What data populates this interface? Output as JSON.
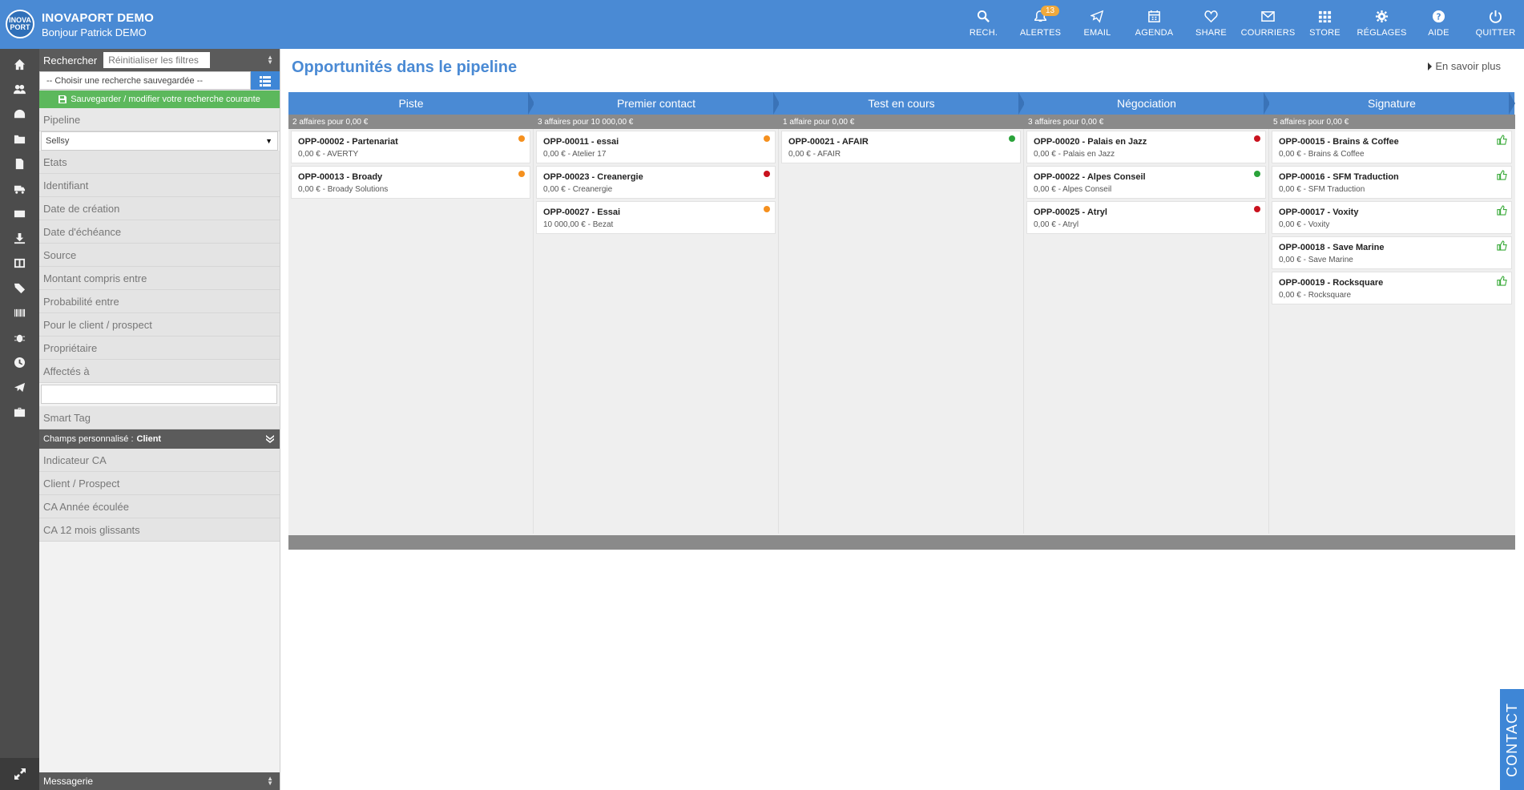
{
  "header": {
    "logo_line1": "INOVA",
    "logo_line2": "PORT",
    "app_name": "INOVAPORT DEMO",
    "greeting": "Bonjour Patrick DEMO",
    "nav": [
      {
        "id": "search",
        "label": "RECH.",
        "icon": "search-icon"
      },
      {
        "id": "alerts",
        "label": "ALERTES",
        "icon": "bell-icon",
        "badge": "13"
      },
      {
        "id": "email",
        "label": "EMAIL",
        "icon": "paper-plane-icon"
      },
      {
        "id": "agenda",
        "label": "AGENDA",
        "icon": "calendar-icon"
      },
      {
        "id": "share",
        "label": "SHARE",
        "icon": "heart-icon"
      },
      {
        "id": "courriers",
        "label": "COURRIERS",
        "icon": "envelope-icon"
      },
      {
        "id": "store",
        "label": "STORE",
        "icon": "grid-icon"
      },
      {
        "id": "settings",
        "label": "RÉGLAGES",
        "icon": "gear-icon"
      },
      {
        "id": "help",
        "label": "AIDE",
        "icon": "question-icon"
      },
      {
        "id": "quit",
        "label": "QUITTER",
        "icon": "power-icon"
      }
    ]
  },
  "rail": {
    "icons": [
      "home-icon",
      "users-icon",
      "dashboard-icon",
      "folder-icon",
      "document-icon",
      "truck-icon",
      "money-icon",
      "download-icon",
      "columns-icon",
      "tags-icon",
      "barcode-icon",
      "bug-icon",
      "clock-icon",
      "send-icon",
      "briefcase-icon"
    ],
    "bottom_icon": "expand-icon"
  },
  "filters": {
    "search_label": "Rechercher",
    "reset_label": "Réinitialiser les filtres",
    "saved_search_placeholder": "-- Choisir une recherche sauvegardée --",
    "save_button": "Sauvegarder / modifier votre recherche courante",
    "pipeline_label": "Pipeline",
    "pipeline_value": "Sellsy",
    "items_before_input": [
      "Etats",
      "Identifiant",
      "Date de création",
      "Date d'échéance",
      "Source",
      "Montant compris entre",
      "Probabilité entre",
      "Pour le client / prospect",
      "Propriétaire",
      "Affectés à"
    ],
    "smart_tag": "Smart Tag",
    "custom_fields_label": "Champs personnalisé :",
    "custom_fields_value": "Client",
    "custom_items": [
      "Indicateur CA",
      "Client / Prospect",
      "CA Année écoulée",
      "CA 12 mois glissants"
    ],
    "messagerie": "Messagerie"
  },
  "main": {
    "title": "Opportunités dans le pipeline",
    "learn_more": "En savoir plus",
    "colors": {
      "orange": "#f5901e",
      "red": "#c9121e",
      "green": "#2aa33a",
      "thumb": "#3bab3b"
    },
    "stages": [
      {
        "name": "Piste",
        "summary": "2 affaires pour 0,00 €",
        "cards": [
          {
            "title": "OPP-00002 - Partenariat",
            "sub": "0,00 € - AVERTY",
            "status": "orange"
          },
          {
            "title": "OPP-00013 - Broady",
            "sub": "0,00 € - Broady Solutions",
            "status": "orange"
          }
        ]
      },
      {
        "name": "Premier contact",
        "summary": "3 affaires pour 10 000,00 €",
        "cards": [
          {
            "title": "OPP-00011 - essai",
            "sub": "0,00 € - Atelier 17",
            "status": "orange"
          },
          {
            "title": "OPP-00023 - Creanergie",
            "sub": "0,00 € - Creanergie",
            "status": "red"
          },
          {
            "title": "OPP-00027 - Essai",
            "sub": "10 000,00 € - Bezat",
            "status": "orange"
          }
        ]
      },
      {
        "name": "Test en cours",
        "summary": "1 affaire pour 0,00 €",
        "cards": [
          {
            "title": "OPP-00021 - AFAIR",
            "sub": "0,00 € - AFAIR",
            "status": "green"
          }
        ]
      },
      {
        "name": "Négociation",
        "summary": "3 affaires pour 0,00 €",
        "cards": [
          {
            "title": "OPP-00020 - Palais en Jazz",
            "sub": "0,00 € - Palais en Jazz",
            "status": "red"
          },
          {
            "title": "OPP-00022 - Alpes Conseil",
            "sub": "0,00 € - Alpes Conseil",
            "status": "green"
          },
          {
            "title": "OPP-00025 - Atryl",
            "sub": "0,00 € - Atryl",
            "status": "red"
          }
        ]
      },
      {
        "name": "Signature",
        "summary": "5 affaires pour 0,00 €",
        "cards": [
          {
            "title": "OPP-00015 - Brains & Coffee",
            "sub": "0,00 € - Brains & Coffee",
            "status": "won"
          },
          {
            "title": "OPP-00016 - SFM Traduction",
            "sub": "0,00 € - SFM Traduction",
            "status": "won"
          },
          {
            "title": "OPP-00017 - Voxity",
            "sub": "0,00 € - Voxity",
            "status": "won"
          },
          {
            "title": "OPP-00018 - Save Marine",
            "sub": "0,00 € - Save Marine",
            "status": "won"
          },
          {
            "title": "OPP-00019 - Rocksquare",
            "sub": "0,00 € - Rocksquare",
            "status": "won"
          }
        ]
      }
    ]
  },
  "contact_tab": "CONTACT"
}
